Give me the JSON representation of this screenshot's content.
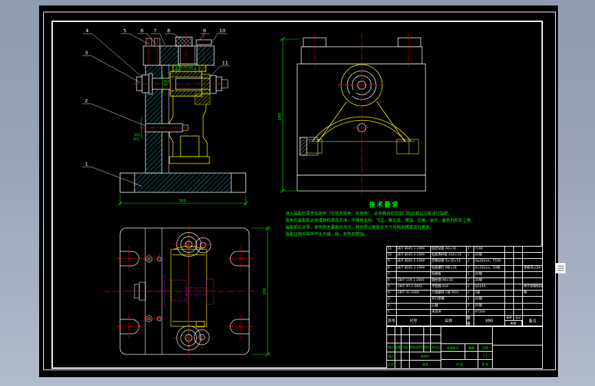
{
  "drawing": {
    "balloons": [
      "1",
      "2",
      "3",
      "4",
      "5",
      "6",
      "7",
      "8",
      "9",
      "10",
      "11"
    ],
    "dimensions": {
      "front_width": "300",
      "side_height": "280",
      "plan_height": "240",
      "fit_top": "Ø22H7/g6",
      "fit_left_1": "Ø16",
      "fit_left_2": "H7",
      "screw_1": "M12",
      "screw_2": "Ø12"
    }
  },
  "tech_requirements": {
    "title": "技术要求",
    "lines": [
      "进入装配的零件及部件（包括外购件、外协件），必须具有检验部门的合格证方能进行装配。",
      "零件在装配前必须清理和清洗干净，不得有毛刺、飞边、氧化皮、锈蚀、切屑、油污、着色剂和灰尘等。",
      "装配前应对零、部件的主要配合尺寸，特别是过盈配合尺寸及相关精度进行复查。",
      "装配过程中零件不允许磕、碰、划伤和锈蚀。"
    ]
  },
  "bom": {
    "headers": {
      "no": "序号",
      "code": "代号",
      "name": "名称",
      "qty": "数量",
      "material": "材料",
      "unit": "单件",
      "total": "总计",
      "weight": "重量",
      "remark": "备注"
    },
    "rows": [
      {
        "no": "11",
        "code": "JB/T 8045.1-1999",
        "name": "固定钻套 A6×10",
        "qty": "1",
        "material": "T10A",
        "remark": ""
      },
      {
        "no": "10",
        "code": "JB/T 8045.4-1999",
        "name": "钻套用衬套 A10×16",
        "qty": "1",
        "material": "45钢",
        "remark": ""
      },
      {
        "no": "9",
        "code": "JB/T 8045.2-1999",
        "name": "可换钻套 6×10×16",
        "qty": "2",
        "material": "d≤26mm，T10A",
        "remark": ""
      },
      {
        "no": "8",
        "code": "JB/T 8045.3-1999",
        "name": "钻套螺钉 M8×16",
        "qty": "2",
        "material": "d>26mm，20钢",
        "remark": "渗碳淬火58～64HRC"
      },
      {
        "no": "7",
        "code": "",
        "name": "钻模板",
        "qty": "1",
        "material": "45钢",
        "remark": ""
      },
      {
        "no": "6",
        "code": "GB/T 119.1-2000",
        "name": "圆柱销 A6×30",
        "qty": "2",
        "material": "35钢",
        "remark": ""
      },
      {
        "no": "5",
        "code": "GB/T 97.1-2002",
        "name": "平垫圈 A10",
        "qty": "2",
        "material": "Q235A",
        "remark": "用不锈钢制成"
      },
      {
        "no": "4",
        "code": "GB/T 41-2000",
        "name": "六角螺母 C级 M10",
        "qty": "2",
        "material": "5级",
        "remark": "钢"
      },
      {
        "no": "3",
        "code": "",
        "name": "开口垫圈",
        "qty": "1",
        "material": "45钢",
        "remark": ""
      },
      {
        "no": "2",
        "code": "",
        "name": "心轴",
        "qty": "1",
        "material": "45钢",
        "remark": ""
      },
      {
        "no": "1",
        "code": "",
        "name": "夹具体",
        "qty": "1",
        "material": "HT200",
        "remark": ""
      }
    ]
  },
  "title_block": {
    "revision_labels": [
      "标记",
      "处数",
      "分区",
      "更改文件号",
      "签名",
      "年月日"
    ],
    "role_design": "设计",
    "role_check": "审核",
    "role_process": "工艺",
    "role_standard": "标准化",
    "role_approve": "批准",
    "stage_label": "阶段标记",
    "weight_label": "重量",
    "scale_label": "比例",
    "scale_value": "1:1",
    "sheet_total": "共 张",
    "sheet_index": "第 张"
  },
  "colors": {
    "desktop": "#98a4b6",
    "sheet": "#000000",
    "line": "#ffffff",
    "hatch": "#00e0e0",
    "part": "#ffff00",
    "centerline": "#ff0000",
    "dimension": "#00ff00",
    "hidden": "#ff00ff"
  }
}
